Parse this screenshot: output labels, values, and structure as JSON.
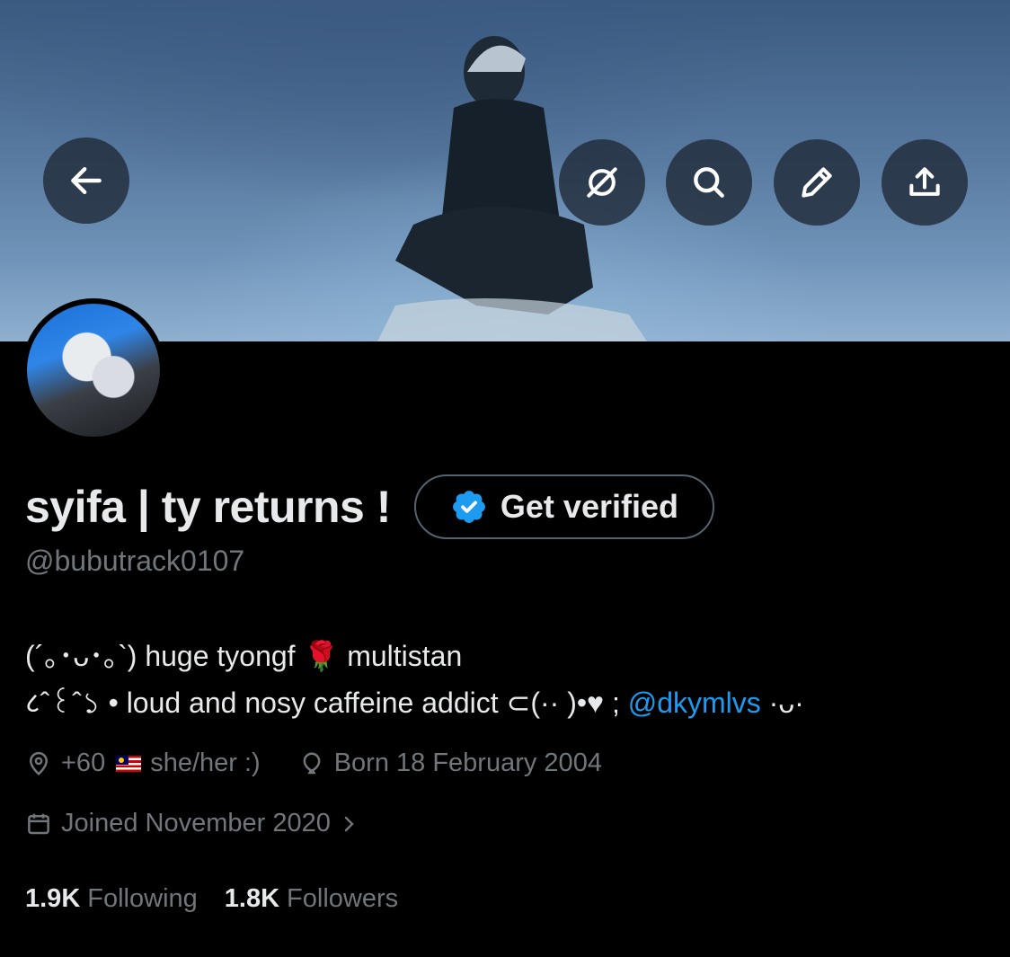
{
  "header": {
    "back_icon": "arrow-left-icon",
    "actions": [
      "grok-icon",
      "search-icon",
      "edit-pencil-icon",
      "share-upload-icon"
    ]
  },
  "profile": {
    "display_name": "syifa | ty returns !",
    "handle": "@bubutrack0107",
    "verify_button_label": "Get verified",
    "bio_line1": "(´｡･ᴗ･｡`) huge tyongf 🌹 multistan",
    "bio_line2_text": "८ˆ꒰ˆ১ • loud and nosy caffeine addict  ⊂(·· )•♥ ; ",
    "bio_mention": "@dkymlvs",
    "bio_line2_tail": " ·ᴗ·",
    "location_prefix": "+60",
    "location_suffix": "she/her :)",
    "birthday": "Born 18 February 2004",
    "joined": "Joined November 2020"
  },
  "stats": {
    "following_count": "1.9K",
    "following_label": "Following",
    "followers_count": "1.8K",
    "followers_label": "Followers"
  },
  "colors": {
    "background": "#000000",
    "text_primary": "#e7e9ea",
    "text_secondary": "#71767b",
    "link": "#1d9bf0",
    "verify_badge": "#1d9bf0"
  }
}
